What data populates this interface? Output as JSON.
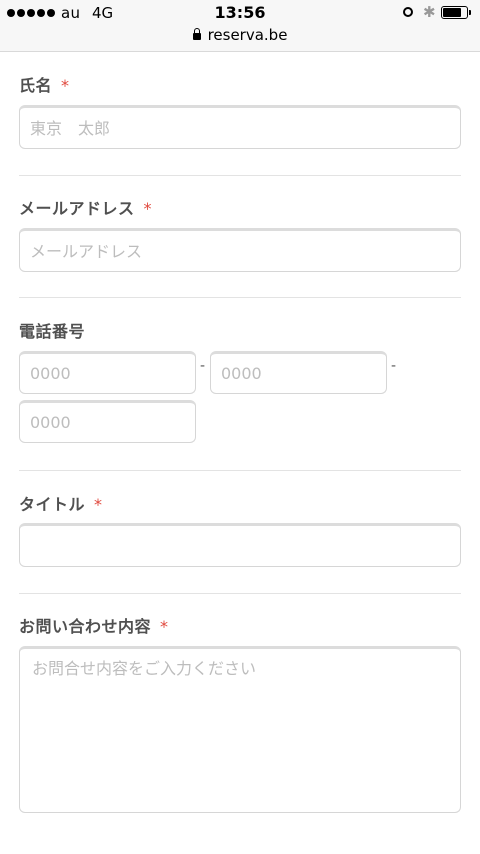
{
  "status_bar": {
    "carrier": "au",
    "network": "4G",
    "time": "13:56",
    "url": "reserva.be",
    "bluetooth_glyph": "✱"
  },
  "form": {
    "name": {
      "label": "氏名",
      "required_mark": "*",
      "placeholder": "東京　太郎"
    },
    "email": {
      "label": "メールアドレス",
      "required_mark": "*",
      "placeholder": "メールアドレス"
    },
    "phone": {
      "label": "電話番号",
      "part1_placeholder": "0000",
      "part2_placeholder": "0000",
      "part3_placeholder": "0000",
      "separator": "-"
    },
    "title": {
      "label": "タイトル",
      "required_mark": "*",
      "placeholder": ""
    },
    "inquiry": {
      "label": "お問い合わせ内容",
      "required_mark": "*",
      "placeholder": "お問合せ内容をご入力ください"
    }
  }
}
